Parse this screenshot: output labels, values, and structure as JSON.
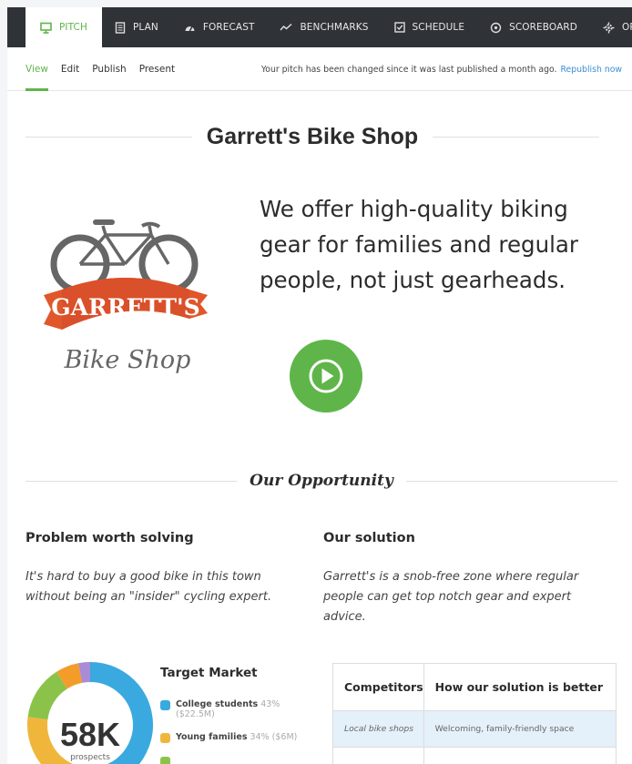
{
  "nav": {
    "items": [
      {
        "label": "PITCH",
        "icon": "monitor-icon"
      },
      {
        "label": "PLAN",
        "icon": "document-icon"
      },
      {
        "label": "FORECAST",
        "icon": "gauge-icon"
      },
      {
        "label": "BENCHMARKS",
        "icon": "trend-icon"
      },
      {
        "label": "SCHEDULE",
        "icon": "checkbox-icon"
      },
      {
        "label": "SCOREBOARD",
        "icon": "dial-icon"
      },
      {
        "label": "OPTIONS",
        "icon": "gear-icon"
      }
    ],
    "accent": "#5fb54a",
    "background": "#2f3236"
  },
  "subnav": {
    "tabs": [
      "View",
      "Edit",
      "Publish",
      "Present"
    ],
    "notice": "Your pitch has been changed since it was last published a month ago.",
    "republish": "Republish now"
  },
  "pitch": {
    "title": "Garrett's Bike Shop",
    "headline": "We offer high-quality biking gear for families and regular people, not just gearheads.",
    "logo": {
      "line1": "GARRETT'S",
      "line2": "Bike Shop"
    }
  },
  "opportunity": {
    "heading": "Our Opportunity",
    "problem_title": "Problem worth solving",
    "problem_text": "It's hard to buy a good bike in this town without being an \"insider\" cycling expert.",
    "solution_title": "Our solution",
    "solution_text": "Garrett's is a snob-free zone where regular people can get top notch gear and expert advice."
  },
  "target_market": {
    "title": "Target Market",
    "total": "58K",
    "total_label": "prospects",
    "segments": [
      {
        "name": "College students",
        "detail": "43%",
        "amount": "($22.5M)",
        "color": "#3aa9e0"
      },
      {
        "name": "Young families",
        "detail": "34% ($6M)",
        "color": "#f0b63c"
      },
      {
        "name": "",
        "detail": "",
        "color": "#8bc34a"
      },
      {
        "name": "",
        "detail": "",
        "color": "#f39c2a"
      },
      {
        "name": "",
        "detail": "",
        "color": "#a98bd6"
      }
    ],
    "segment_shares": [
      43,
      34,
      14,
      6,
      3
    ]
  },
  "competitors": {
    "headers": [
      "Competitors",
      "How our solution is better"
    ],
    "rows": [
      [
        "Local bike shops",
        "Welcoming, family-friendly space"
      ]
    ]
  }
}
